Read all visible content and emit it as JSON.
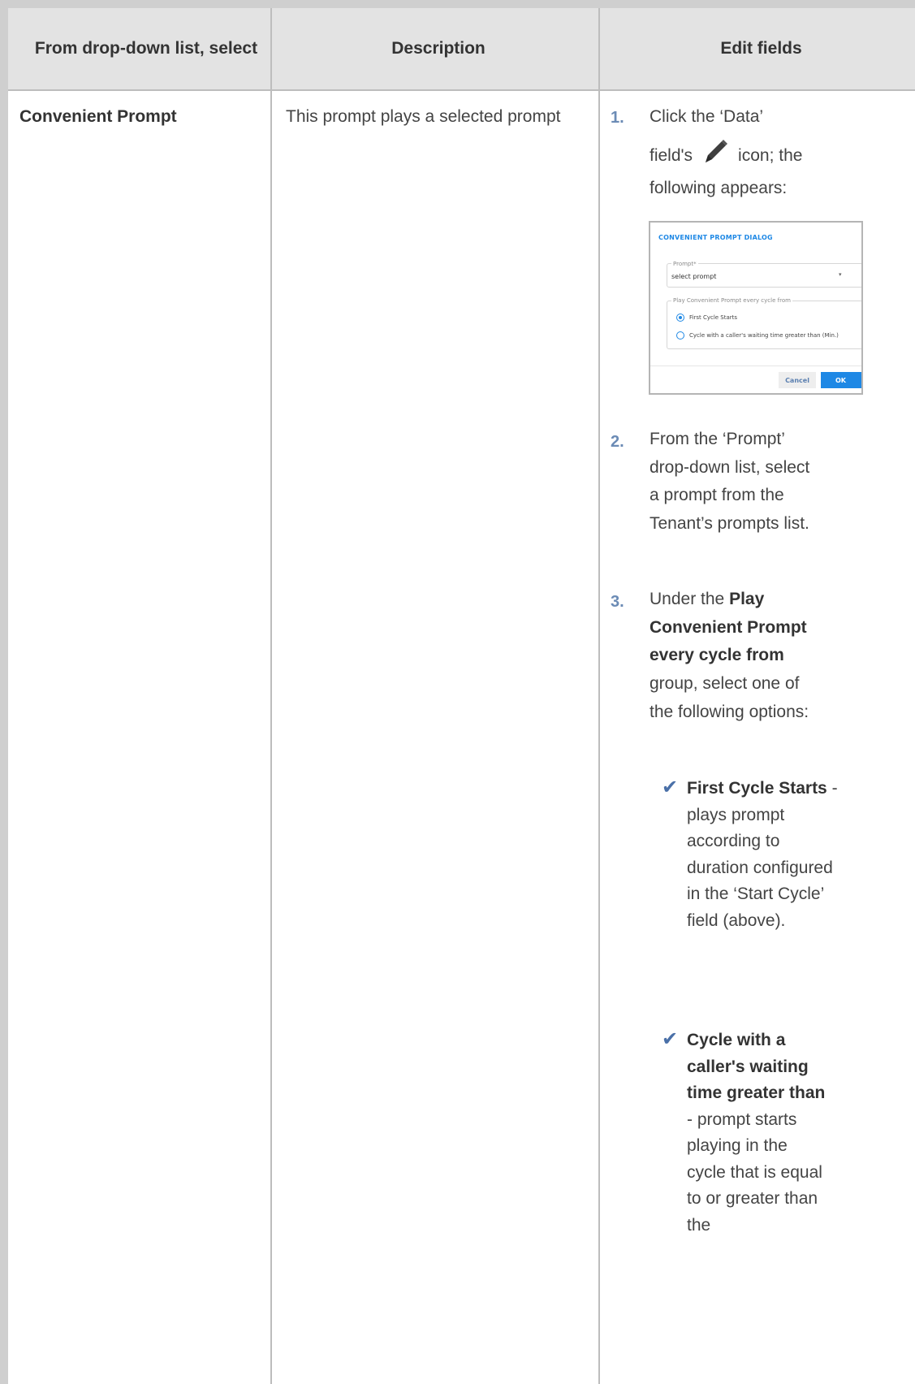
{
  "table": {
    "headers": [
      "From drop-down list, select",
      "Description",
      "Edit fields"
    ],
    "row": {
      "option": "Convenient Prompt",
      "description": "This prompt plays a selected prompt"
    }
  },
  "steps": {
    "s1_num": "1.",
    "s1_a": "Click the ‘Data’",
    "s1_b": "field's",
    "s1_c": "icon; the",
    "s1_d": "following appears:",
    "s2_num": "2.",
    "s2_text": "From the ‘Prompt’ drop-down list, select a prompt from the Tenant’s prompts list.",
    "s3_num": "3.",
    "s3_pre": "Under the",
    "s3_bold": "Play Convenient Prompt every cycle from",
    "s3_post": "group, select one of the following options:"
  },
  "bullets": [
    {
      "bold": "First Cycle Starts",
      "text": " - plays prompt according to duration configured in the ‘Start Cycle’ field (above)."
    },
    {
      "bold": "Cycle with a caller's waiting time greater than",
      "text": " - prompt starts playing in the cycle that is equal to or greater than the"
    }
  ],
  "dialog": {
    "title": "CONVENIENT PROMPT DIALOG",
    "prompt_label": "Prompt*",
    "prompt_value": "select prompt",
    "group_label": "Play Convenient Prompt every cycle from",
    "option_1": "First Cycle Starts",
    "option_2": "Cycle with a caller's waiting time greater than (Min.)",
    "option_selected": 1,
    "cancel": "Cancel",
    "ok": "OK"
  },
  "icons": {
    "edit": "pencil-icon",
    "check": "checkmark-icon"
  },
  "colors": {
    "step_number": "#6b8bb5",
    "check": "#4a70a8",
    "dialog_accent": "#1e88e5",
    "header_bg": "#e3e3e3"
  }
}
